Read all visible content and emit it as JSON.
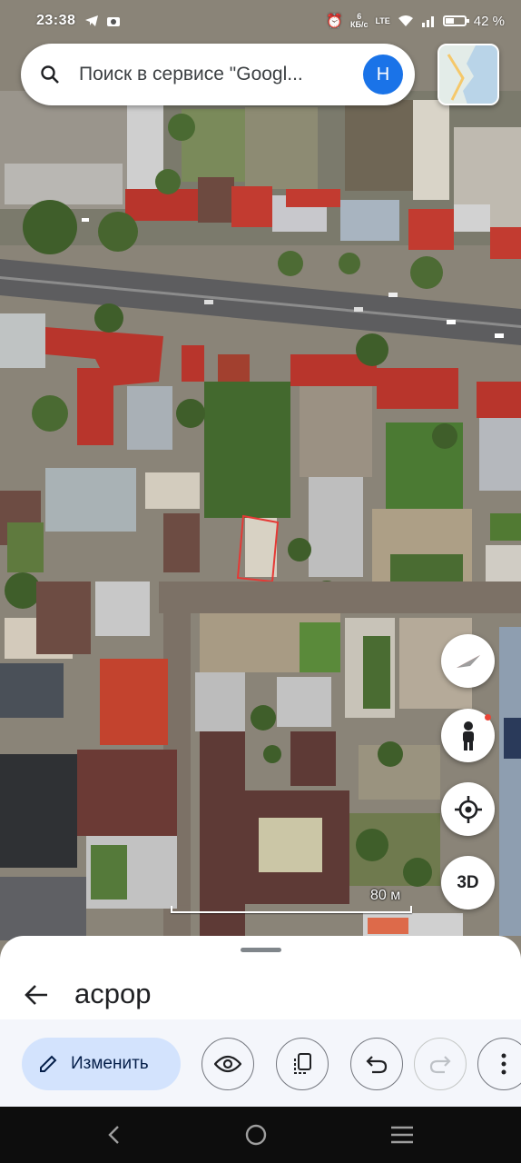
{
  "status_bar": {
    "time": "23:38",
    "net_speed_value": "6",
    "net_speed_unit": "КБ/с",
    "network_type": "LTE",
    "battery": "42 %"
  },
  "search": {
    "placeholder": "Поиск в сервисе \"Google Карты\"",
    "text": "Поиск в сервисе \"Googl...",
    "avatar_letter": "Н"
  },
  "map": {
    "scale_label": "80 м",
    "controls": {
      "three_d_label": "3D"
    }
  },
  "sheet": {
    "title": "асрор",
    "edit_label": "Изменить"
  },
  "colors": {
    "accent": "#1a73e8",
    "edit_button_bg": "#d3e3fd",
    "selection_outline": "#e53935",
    "compass_red": "#e53935"
  },
  "icons": [
    "search-icon",
    "camera-icon",
    "wifi-icon",
    "signal-icon",
    "battery-icon",
    "compass-icon",
    "pegman-icon",
    "my-location-icon",
    "back-arrow-icon",
    "pencil-icon",
    "eye-icon",
    "copy-icon",
    "undo-icon",
    "redo-icon",
    "more-vert-icon",
    "nav-back-icon",
    "nav-home-icon",
    "nav-recents-icon"
  ]
}
